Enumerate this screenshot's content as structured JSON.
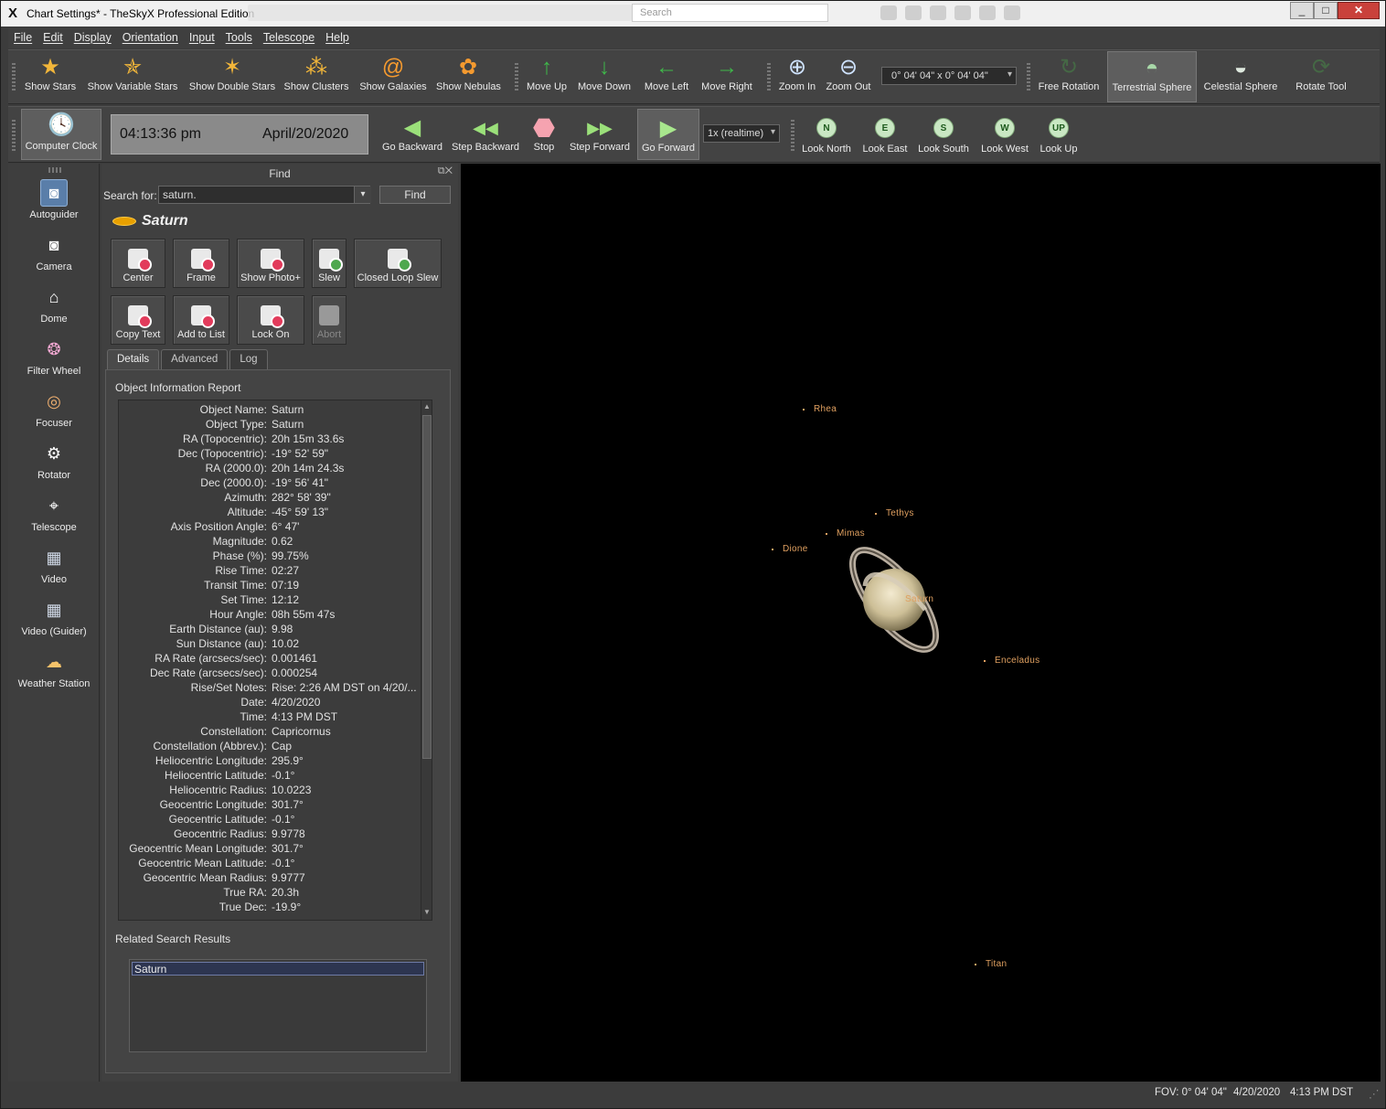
{
  "window": {
    "title": "Chart Settings* - TheSkyX Professional Edition",
    "search_placeholder": "Search",
    "buttons": [
      "_",
      "□",
      "✕"
    ]
  },
  "menu": [
    "File",
    "Edit",
    "Display",
    "Orientation",
    "Input",
    "Tools",
    "Telescope",
    "Help"
  ],
  "toolbar1": {
    "items": [
      "Show Stars",
      "Show Variable Stars",
      "Show Double Stars",
      "Show Clusters",
      "Show Galaxies",
      "Show Nebulas",
      "Move Up",
      "Move Down",
      "Move Left",
      "Move Right",
      "Zoom In",
      "Zoom Out"
    ],
    "fov": "0° 04' 04\" x 0° 04' 04\"",
    "right_items": [
      "Free Rotation",
      "Terrestrial Sphere",
      "Celestial Sphere",
      "Rotate Tool"
    ]
  },
  "toolbar2": {
    "clock_label": "Computer Clock",
    "time": "04:13:36 pm",
    "date": "April/20/2020",
    "items": [
      "Go Backward",
      "Step Backward",
      "Stop",
      "Step Forward",
      "Go Forward"
    ],
    "rate": "1x (realtime)",
    "look": [
      {
        "label": "Look North",
        "letter": "N"
      },
      {
        "label": "Look East",
        "letter": "E"
      },
      {
        "label": "Look South",
        "letter": "S"
      },
      {
        "label": "Look West",
        "letter": "W"
      },
      {
        "label": "Look Up",
        "letter": "UP"
      }
    ]
  },
  "devices": [
    "Autoguider",
    "Camera",
    "Dome",
    "Filter Wheel",
    "Focuser",
    "Rotator",
    "Telescope",
    "Video",
    "Video (Guider)",
    "Weather Station"
  ],
  "find": {
    "header": "Find",
    "search_label": "Search for:",
    "search_value": "saturn.",
    "find_button": "Find",
    "object": "Saturn",
    "actions_row1": [
      "Center",
      "Frame",
      "Show Photo+",
      "Slew",
      "Closed Loop Slew"
    ],
    "actions_row2": [
      "Copy Text",
      "Add to List",
      "Lock On",
      "Abort"
    ],
    "tabs": [
      "Details",
      "Advanced",
      "Log"
    ],
    "report_title": "Object Information Report",
    "report": [
      [
        "Object Name:",
        "Saturn"
      ],
      [
        "Object Type:",
        "Saturn"
      ],
      [
        "RA (Topocentric):",
        "20h 15m 33.6s"
      ],
      [
        "Dec (Topocentric):",
        "-19° 52' 59\""
      ],
      [
        "RA (2000.0):",
        "20h 14m 24.3s"
      ],
      [
        "Dec (2000.0):",
        "-19° 56' 41\""
      ],
      [
        "Azimuth:",
        "282° 58' 39\""
      ],
      [
        "Altitude:",
        "-45° 59' 13\""
      ],
      [
        "Axis Position Angle:",
        "6° 47'"
      ],
      [
        "Magnitude:",
        "0.62"
      ],
      [
        "Phase (%):",
        "99.75%"
      ],
      [
        "Rise Time:",
        "02:27"
      ],
      [
        "Transit Time:",
        "07:19"
      ],
      [
        "Set Time:",
        "12:12"
      ],
      [
        "Hour Angle:",
        "08h 55m 47s"
      ],
      [
        "Earth Distance (au):",
        "9.98"
      ],
      [
        "Sun Distance (au):",
        "10.02"
      ],
      [
        "RA Rate (arcsecs/sec):",
        "0.001461"
      ],
      [
        "Dec Rate (arcsecs/sec):",
        "0.000254"
      ],
      [
        "Rise/Set Notes:",
        "Rise: 2:26 AM DST on 4/20/..."
      ],
      [
        "Date:",
        "4/20/2020"
      ],
      [
        "Time:",
        "4:13 PM DST"
      ],
      [
        "Constellation:",
        "Capricornus"
      ],
      [
        "Constellation (Abbrev.):",
        "Cap"
      ],
      [
        "Heliocentric Longitude:",
        "295.9°"
      ],
      [
        "Heliocentric Latitude:",
        "-0.1°"
      ],
      [
        "Heliocentric Radius:",
        "10.0223"
      ],
      [
        "Geocentric Longitude:",
        "301.7°"
      ],
      [
        "Geocentric Latitude:",
        "-0.1°"
      ],
      [
        "Geocentric Radius:",
        "9.9778"
      ],
      [
        "Geocentric Mean Longitude:",
        "301.7°"
      ],
      [
        "Geocentric Mean Latitude:",
        "-0.1°"
      ],
      [
        "Geocentric Mean Radius:",
        "9.9777"
      ],
      [
        "True RA:",
        "20.3h"
      ],
      [
        "True Dec:",
        "-19.9°"
      ]
    ],
    "related_title": "Related Search Results",
    "related": [
      "Saturn"
    ]
  },
  "sky": {
    "labels": [
      "Rhea",
      "Tethys",
      "Mimas",
      "Dione",
      "Saturn",
      "Enceladus",
      "Titan"
    ]
  },
  "status": {
    "fov": "FOV: 0° 04' 04\"",
    "date": "4/20/2020",
    "time": "4:13 PM DST"
  }
}
